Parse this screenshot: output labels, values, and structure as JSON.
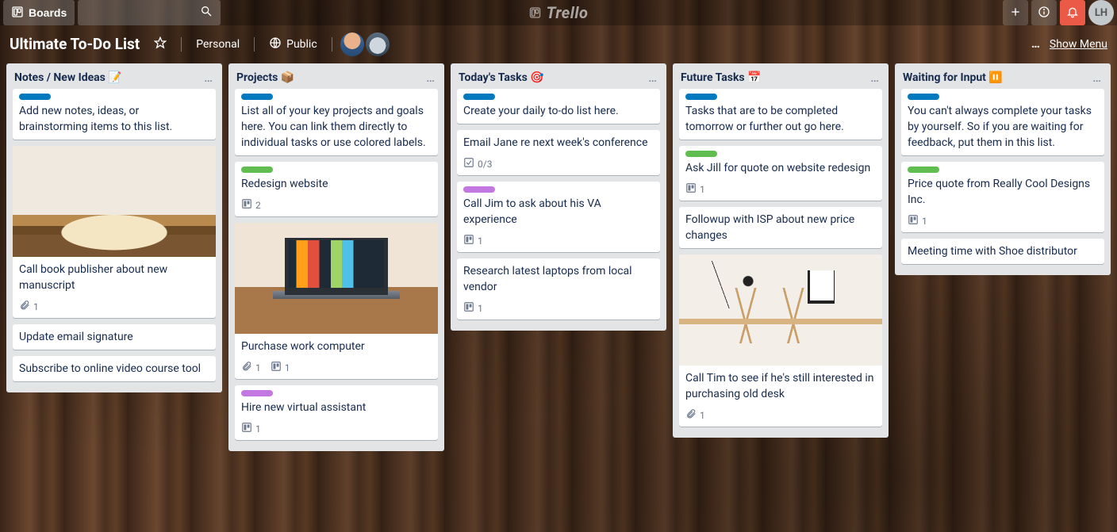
{
  "app": {
    "brand": "Trello"
  },
  "topbar": {
    "boards_label": "Boards",
    "search_placeholder": "",
    "user_initials": "LH"
  },
  "board_header": {
    "title": "Ultimate To-Do List",
    "team_label": "Personal",
    "visibility_label": "Public",
    "show_menu_label": "Show Menu"
  },
  "colors": {
    "label_blue": "#0079bf",
    "label_green": "#61bd4f",
    "label_purple": "#c377e0",
    "notification_red": "#eb5a46"
  },
  "lists": [
    {
      "title": "Notes / New Ideas 📝",
      "cards": [
        {
          "labels": [
            "blue"
          ],
          "text": "Add new notes, ideas, or brainstorming items to this list."
        },
        {
          "cover": "book",
          "text": "Call book publisher about new manuscript",
          "badges": [
            {
              "type": "attachment",
              "value": "1"
            }
          ]
        },
        {
          "text": "Update email signature"
        },
        {
          "text": "Subscribe to online video course tool"
        }
      ]
    },
    {
      "title": "Projects 📦",
      "cards": [
        {
          "labels": [
            "blue"
          ],
          "text": "List all of your key projects and goals here. You can link them directly to individual tasks or use colored labels."
        },
        {
          "labels": [
            "green"
          ],
          "text": "Redesign website",
          "badges": [
            {
              "type": "trello",
              "value": "2"
            }
          ]
        },
        {
          "cover": "laptop",
          "text": "Purchase work computer",
          "badges": [
            {
              "type": "attachment",
              "value": "1"
            },
            {
              "type": "trello",
              "value": "1"
            }
          ]
        },
        {
          "labels": [
            "purple"
          ],
          "text": "Hire new virtual assistant",
          "badges": [
            {
              "type": "trello",
              "value": "1"
            }
          ]
        }
      ]
    },
    {
      "title": "Today's Tasks 🎯",
      "cards": [
        {
          "labels": [
            "blue"
          ],
          "text": "Create your daily to-do list here."
        },
        {
          "text": "Email Jane re next week's conference",
          "badges": [
            {
              "type": "checklist",
              "value": "0/3"
            }
          ]
        },
        {
          "labels": [
            "purple"
          ],
          "text": "Call Jim to ask about his VA experience",
          "badges": [
            {
              "type": "trello",
              "value": "1"
            }
          ]
        },
        {
          "text": "Research latest laptops from local vendor",
          "badges": [
            {
              "type": "trello",
              "value": "1"
            }
          ]
        }
      ]
    },
    {
      "title": "Future Tasks 📅",
      "cards": [
        {
          "labels": [
            "blue"
          ],
          "text": "Tasks that are to be completed tomorrow or further out go here."
        },
        {
          "labels": [
            "green"
          ],
          "text": "Ask Jill for quote on website redesign",
          "badges": [
            {
              "type": "trello",
              "value": "1"
            }
          ]
        },
        {
          "text": "Followup with ISP about new price changes"
        },
        {
          "cover": "desk",
          "text": "Call Tim to see if he's still interested in purchasing old desk",
          "badges": [
            {
              "type": "attachment",
              "value": "1"
            }
          ]
        }
      ]
    },
    {
      "title": "Waiting for Input ⏸️",
      "cards": [
        {
          "labels": [
            "blue"
          ],
          "text": "You can't always complete your tasks by yourself. So if you are waiting for feedback, put them in this list."
        },
        {
          "labels": [
            "green"
          ],
          "text": "Price quote from Really Cool Designs Inc.",
          "badges": [
            {
              "type": "trello",
              "value": "1"
            }
          ]
        },
        {
          "text": "Meeting time with Shoe distributor"
        }
      ]
    }
  ]
}
